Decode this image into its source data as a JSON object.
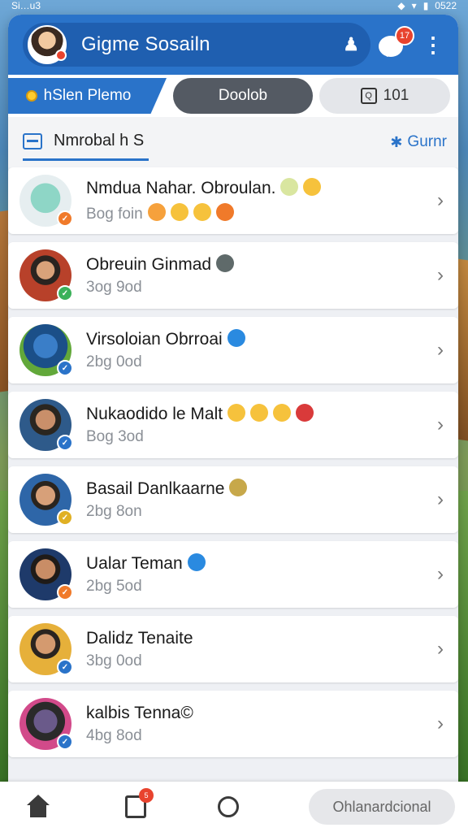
{
  "status_bar": {
    "left": "Si…u3",
    "time": "0522"
  },
  "header": {
    "title": "Gigme Sosailn",
    "friends_icon": "person-icon",
    "chat_badge": "17",
    "menu_icon": "kebab-icon"
  },
  "tabs": [
    {
      "label": "hSlen Plemo"
    },
    {
      "label": "Doolob"
    },
    {
      "label": "101"
    }
  ],
  "filter": {
    "label": "Nmrobal  h S",
    "right_label": "Gurnr"
  },
  "friends": [
    {
      "name": "Nmdua Nahar. Obroulan.",
      "sub": "Bog foin",
      "badge_color": "#f07a2a",
      "avatar_bg": "radial-gradient(circle at 50% 45%, #8ed6c6 0 38%, #e6eef0 39%)",
      "emojis": [
        "#d9e6a0",
        "#f6c23c"
      ],
      "sub_emojis": [
        "#f6a13c",
        "#f6c23c",
        "#f6c23c",
        "#f07a2a"
      ]
    },
    {
      "name": "Obreuin Ginmad",
      "sub": "3og 9od",
      "badge_color": "#3bb15a",
      "avatar_bg": "radial-gradient(circle at 50% 40%, #d9a27a 0 22%, #2a2420 23% 36%, #b8412a 37%)",
      "emojis": [
        "#5f6a6a"
      ],
      "sub_emojis": []
    },
    {
      "name": "Virsoloian Obrroai",
      "sub": "2bg 0od",
      "badge_color": "#2a73c9",
      "avatar_bg": "radial-gradient(circle at 50% 42%, #3a7ec8 0 30%, #1b4f88 31% 55%, #62a83a 56%)",
      "emojis": [
        "#2a8ae0"
      ],
      "sub_emojis": []
    },
    {
      "name": "Nukaodido le Malt",
      "sub": "Bog 3od",
      "badge_color": "#2a73c9",
      "avatar_bg": "radial-gradient(circle at 50% 40%, #c98f6a 0 24%, #2a2620 25% 38%, #2e5a8a 39%)",
      "emojis": [
        "#f6c23c",
        "#f6c23c",
        "#f6c23c",
        "#d93a3a"
      ],
      "sub_emojis": []
    },
    {
      "name": "Basail Danlkaarne",
      "sub": "2bg 8on",
      "badge_color": "#e0b024",
      "avatar_bg": "radial-gradient(circle at 50% 42%, #d7a079 0 24%, #2a241e 25% 36%, #2e66a8 37%)",
      "emojis": [
        "#c7a84a"
      ],
      "sub_emojis": []
    },
    {
      "name": "Ualar Teman",
      "sub": "2bg 5od",
      "badge_color": "#f07a2a",
      "avatar_bg": "radial-gradient(circle at 50% 40%, #c98d66 0 24%, #1f1b18 25% 36%, #1e3a6a 37%)",
      "emojis": [
        "#2a8ae0"
      ],
      "sub_emojis": []
    },
    {
      "name": "Dalidz Tenaite",
      "sub": "3bg 0od",
      "badge_color": "#2a73c9",
      "avatar_bg": "radial-gradient(circle at 50% 40%, #d49a6f 0 24%, #2a2420 25% 36%, #e6b03a 37%)",
      "emojis": [],
      "sub_emojis": []
    },
    {
      "name": "kalbis Tenna©",
      "sub": "4bg 8od",
      "badge_color": "#2a73c9",
      "avatar_bg": "radial-gradient(circle at 50% 45%, #6a5a8a 0 30%, #2a2a2a 31% 50%, #d24a8a 51%)",
      "emojis": [],
      "sub_emojis": []
    }
  ],
  "bottom_nav": {
    "doc_badge": "5",
    "button_label": "Ohlanardcional"
  },
  "colors": {
    "primary": "#2a73c9",
    "badge": "#e8432e"
  }
}
